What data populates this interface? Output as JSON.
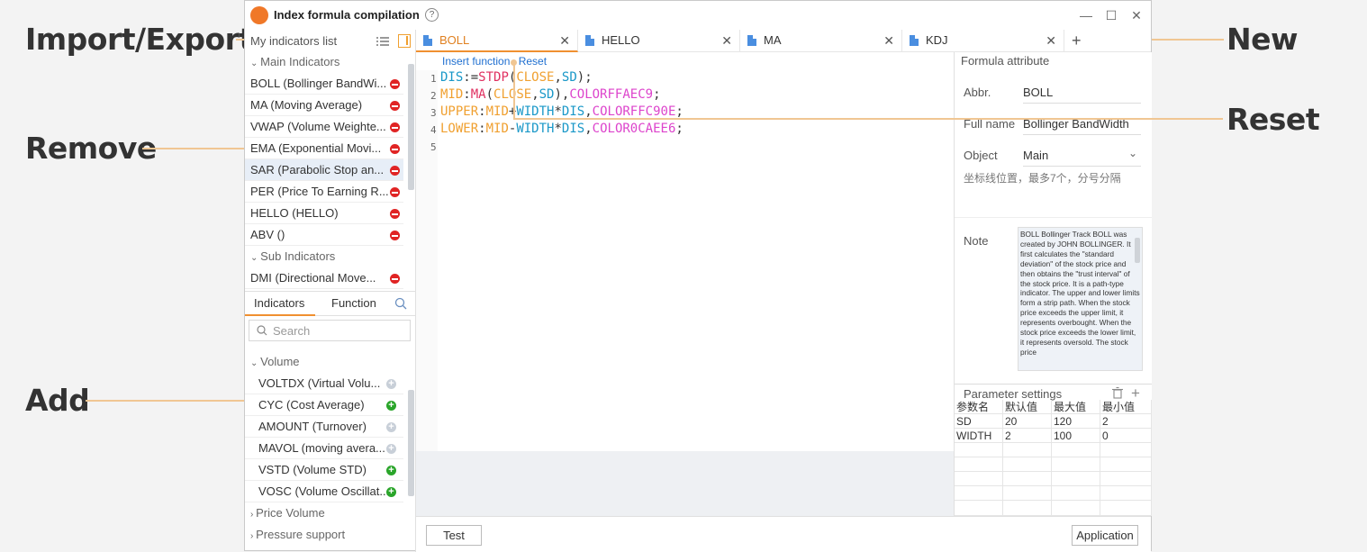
{
  "callouts": {
    "import_export": "Import/Export",
    "remove": "Remove",
    "add": "Add",
    "new": "New",
    "reset": "Reset"
  },
  "window": {
    "title": "Index formula compilation",
    "help": "?",
    "minimize": "—",
    "maximize": "☐",
    "close": "✕"
  },
  "left": {
    "header": "My indicators list",
    "main_group": "Main Indicators",
    "main_items": [
      "BOLL (Bollinger BandWi...",
      "MA (Moving Average)",
      "VWAP (Volume Weighte...",
      "EMA (Exponential Movi...",
      "SAR (Parabolic Stop an...",
      "PER (Price To Earning R...",
      "HELLO (HELLO)",
      "ABV ()"
    ],
    "sub_group": "Sub Indicators",
    "sub_items": [
      "DMI (Directional Move..."
    ],
    "tab_indicators": "Indicators",
    "tab_function": "Function",
    "search_placeholder": "Search",
    "volume_group": "Volume",
    "volume_items": [
      "VOLTDX (Virtual Volu...",
      "CYC (Cost Average)",
      "AMOUNT (Turnover)",
      "MAVOL (moving avera...",
      "VSTD (Volume STD)",
      "VOSC (Volume Oscillat..."
    ],
    "price_volume": "Price Volume",
    "pressure_support": "Pressure support"
  },
  "tabs": [
    {
      "label": "BOLL",
      "active": true
    },
    {
      "label": "HELLO",
      "active": false
    },
    {
      "label": "MA",
      "active": false
    },
    {
      "label": "KDJ",
      "active": false
    }
  ],
  "editor": {
    "insert_function": "Insert function",
    "reset": "Reset",
    "line_numbers": [
      "1",
      "2",
      "3",
      "4",
      "5"
    ]
  },
  "attributes": {
    "header": "Formula attribute",
    "abbr_label": "Abbr.",
    "abbr_value": "BOLL",
    "fullname_label": "Full name",
    "fullname_value": "Bollinger BandWidth",
    "object_label": "Object",
    "object_value": "Main",
    "hint": "坐标线位置，最多7个，分号分隔",
    "note_label": "Note",
    "note_text": "BOLL Bollinger Track\nBOLL was created by JOHN BOLLINGER. It first calculates the \"standard deviation\" of the stock price and then obtains the \"trust interval\" of the stock price. It is a path-type indicator. The upper and lower limits form a strip path. When the stock price exceeds the upper limit, it represents overbought. When the stock price exceeds the lower limit, it represents oversold. The stock price"
  },
  "params": {
    "header": "Parameter settings",
    "columns": [
      "参数名",
      "默认值",
      "最大值",
      "最小值"
    ],
    "rows": [
      [
        "SD",
        "20",
        "120",
        "2"
      ],
      [
        "WIDTH",
        "2",
        "100",
        "0"
      ]
    ]
  },
  "buttons": {
    "test": "Test",
    "application": "Application"
  }
}
